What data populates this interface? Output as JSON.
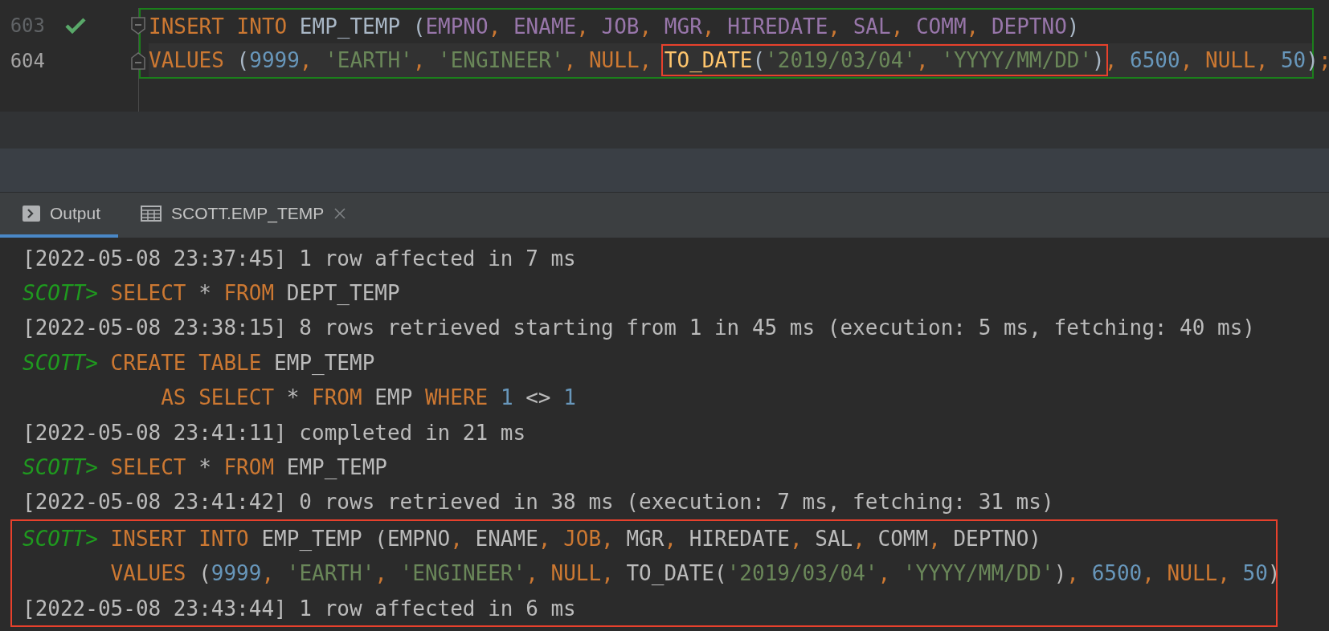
{
  "editor": {
    "statement_outlined": true,
    "lines": [
      {
        "number": "603",
        "current": false,
        "executed": true,
        "tokens": [
          {
            "kind": "kw",
            "text": "INSERT INTO"
          },
          {
            "kind": "plain",
            "text": " EMP_TEMP ("
          },
          {
            "kind": "col",
            "text": "EMPNO"
          },
          {
            "kind": "comma",
            "text": ", "
          },
          {
            "kind": "col",
            "text": "ENAME"
          },
          {
            "kind": "comma",
            "text": ", "
          },
          {
            "kind": "col",
            "text": "JOB"
          },
          {
            "kind": "comma",
            "text": ", "
          },
          {
            "kind": "col",
            "text": "MGR"
          },
          {
            "kind": "comma",
            "text": ", "
          },
          {
            "kind": "col",
            "text": "HIREDATE"
          },
          {
            "kind": "comma",
            "text": ", "
          },
          {
            "kind": "col",
            "text": "SAL"
          },
          {
            "kind": "comma",
            "text": ", "
          },
          {
            "kind": "col",
            "text": "COMM"
          },
          {
            "kind": "comma",
            "text": ", "
          },
          {
            "kind": "col",
            "text": "DEPTNO"
          },
          {
            "kind": "plain",
            "text": ")"
          }
        ]
      },
      {
        "number": "604",
        "current": true,
        "executed": false,
        "tokens": [
          {
            "kind": "kw",
            "text": "VALUES"
          },
          {
            "kind": "plain",
            "text": " ("
          },
          {
            "kind": "num",
            "text": "9999"
          },
          {
            "kind": "comma",
            "text": ", "
          },
          {
            "kind": "str",
            "text": "'EARTH'"
          },
          {
            "kind": "comma",
            "text": ", "
          },
          {
            "kind": "str",
            "text": "'ENGINEER'"
          },
          {
            "kind": "comma",
            "text": ", "
          },
          {
            "kind": "kw",
            "text": "NULL"
          },
          {
            "kind": "comma",
            "text": ", "
          },
          {
            "kind": "group",
            "boxed": true,
            "tokens": [
              {
                "kind": "fn",
                "text": "TO_DATE"
              },
              {
                "kind": "plain",
                "text": "("
              },
              {
                "kind": "str",
                "text": "'2019/03/04'"
              },
              {
                "kind": "comma",
                "text": ", "
              },
              {
                "kind": "str",
                "text": "'YYYY/MM/DD'"
              },
              {
                "kind": "plain",
                "text": ")"
              }
            ]
          },
          {
            "kind": "comma",
            "text": ", "
          },
          {
            "kind": "num",
            "text": "6500"
          },
          {
            "kind": "comma",
            "text": ", "
          },
          {
            "kind": "kw",
            "text": "NULL"
          },
          {
            "kind": "comma",
            "text": ", "
          },
          {
            "kind": "num",
            "text": "50"
          },
          {
            "kind": "plain",
            "text": ")"
          },
          {
            "kind": "comma",
            "text": ";"
          }
        ]
      }
    ]
  },
  "tabs": [
    {
      "label": "Output",
      "kind": "console",
      "selected": true,
      "closable": false
    },
    {
      "label": "SCOTT.EMP_TEMP",
      "kind": "table",
      "selected": false,
      "closable": true
    }
  ],
  "output": [
    {
      "highlighted": false,
      "tokens": [
        {
          "kind": "plain",
          "text": "[2022-05-08 23:37:45] 1 row affected in 7 ms"
        }
      ]
    },
    {
      "highlighted": false,
      "tokens": [
        {
          "kind": "prompt",
          "text": "SCOTT> "
        },
        {
          "kind": "kw",
          "text": "SELECT"
        },
        {
          "kind": "plain",
          "text": " * "
        },
        {
          "kind": "kw",
          "text": "FROM"
        },
        {
          "kind": "plain",
          "text": " DEPT_TEMP"
        }
      ]
    },
    {
      "highlighted": false,
      "tokens": [
        {
          "kind": "plain",
          "text": "[2022-05-08 23:38:15] 8 rows retrieved starting from 1 in 45 ms (execution: 5 ms, fetching: 40 ms)"
        }
      ]
    },
    {
      "highlighted": false,
      "tokens": [
        {
          "kind": "prompt",
          "text": "SCOTT> "
        },
        {
          "kind": "kw",
          "text": "CREATE TABLE"
        },
        {
          "kind": "plain",
          "text": " EMP_TEMP"
        }
      ]
    },
    {
      "highlighted": false,
      "tokens": [
        {
          "kind": "kw",
          "text": "           AS SELECT"
        },
        {
          "kind": "plain",
          "text": " * "
        },
        {
          "kind": "kw",
          "text": "FROM"
        },
        {
          "kind": "plain",
          "text": " EMP "
        },
        {
          "kind": "kw",
          "text": "WHERE "
        },
        {
          "kind": "num",
          "text": "1"
        },
        {
          "kind": "plain",
          "text": " <> "
        },
        {
          "kind": "num",
          "text": "1"
        }
      ]
    },
    {
      "highlighted": false,
      "tokens": [
        {
          "kind": "plain",
          "text": "[2022-05-08 23:41:11] completed in 21 ms"
        }
      ]
    },
    {
      "highlighted": false,
      "tokens": [
        {
          "kind": "prompt",
          "text": "SCOTT> "
        },
        {
          "kind": "kw",
          "text": "SELECT"
        },
        {
          "kind": "plain",
          "text": " * "
        },
        {
          "kind": "kw",
          "text": "FROM"
        },
        {
          "kind": "plain",
          "text": " EMP_TEMP"
        }
      ]
    },
    {
      "highlighted": false,
      "tokens": [
        {
          "kind": "plain",
          "text": "[2022-05-08 23:41:42] 0 rows retrieved in 38 ms (execution: 7 ms, fetching: 31 ms)"
        }
      ]
    },
    {
      "highlighted": true,
      "tokens": [
        {
          "kind": "prompt",
          "text": "SCOTT> "
        },
        {
          "kind": "kw",
          "text": "INSERT INTO"
        },
        {
          "kind": "plain",
          "text": " EMP_TEMP (EMPNO"
        },
        {
          "kind": "comma",
          "text": ", "
        },
        {
          "kind": "plain",
          "text": "ENAME"
        },
        {
          "kind": "comma",
          "text": ", "
        },
        {
          "kind": "kw",
          "text": "JOB"
        },
        {
          "kind": "comma",
          "text": ", "
        },
        {
          "kind": "plain",
          "text": "MGR"
        },
        {
          "kind": "comma",
          "text": ", "
        },
        {
          "kind": "plain",
          "text": "HIREDATE"
        },
        {
          "kind": "comma",
          "text": ", "
        },
        {
          "kind": "plain",
          "text": "SAL"
        },
        {
          "kind": "comma",
          "text": ", "
        },
        {
          "kind": "plain",
          "text": "COMM"
        },
        {
          "kind": "comma",
          "text": ", "
        },
        {
          "kind": "plain",
          "text": "DEPTNO)"
        }
      ]
    },
    {
      "highlighted": true,
      "tokens": [
        {
          "kind": "kw",
          "text": "       VALUES"
        },
        {
          "kind": "plain",
          "text": " ("
        },
        {
          "kind": "num",
          "text": "9999"
        },
        {
          "kind": "comma",
          "text": ", "
        },
        {
          "kind": "str",
          "text": "'EARTH'"
        },
        {
          "kind": "comma",
          "text": ", "
        },
        {
          "kind": "str",
          "text": "'ENGINEER'"
        },
        {
          "kind": "comma",
          "text": ", "
        },
        {
          "kind": "kw",
          "text": "NULL"
        },
        {
          "kind": "comma",
          "text": ", "
        },
        {
          "kind": "plain",
          "text": "TO_DATE("
        },
        {
          "kind": "str",
          "text": "'2019/03/04'"
        },
        {
          "kind": "comma",
          "text": ", "
        },
        {
          "kind": "str",
          "text": "'YYYY/MM/DD'"
        },
        {
          "kind": "plain",
          "text": ")"
        },
        {
          "kind": "comma",
          "text": ", "
        },
        {
          "kind": "num",
          "text": "6500"
        },
        {
          "kind": "comma",
          "text": ", "
        },
        {
          "kind": "kw",
          "text": "NULL"
        },
        {
          "kind": "comma",
          "text": ", "
        },
        {
          "kind": "num",
          "text": "50"
        },
        {
          "kind": "plain",
          "text": ")"
        }
      ]
    },
    {
      "highlighted": true,
      "tokens": [
        {
          "kind": "plain",
          "text": "[2022-05-08 23:43:44] 1 row affected in 6 ms"
        }
      ]
    }
  ]
}
